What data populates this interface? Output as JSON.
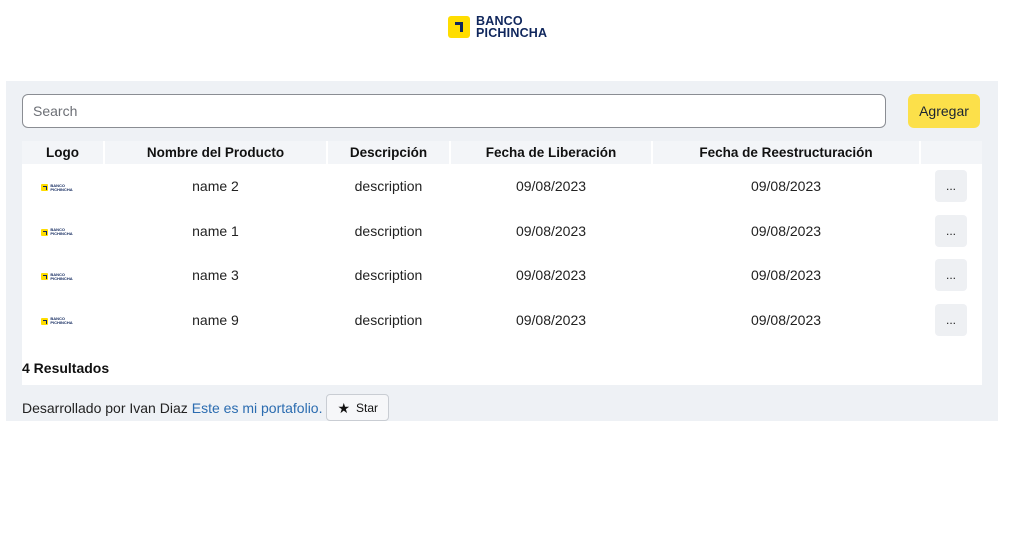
{
  "brand": {
    "line1": "BANCO",
    "line2": "PICHINCHA",
    "color": "#0f265c",
    "accent": "#ffdd00"
  },
  "search": {
    "placeholder": "Search",
    "value": ""
  },
  "toolbar": {
    "add_label": "Agregar"
  },
  "table": {
    "columns": [
      "Logo",
      "Nombre del Producto",
      "Descripción",
      "Fecha de Liberación",
      "Fecha de Reestructuración",
      ""
    ],
    "rows": [
      {
        "logo_line1": "BANCO",
        "logo_line2": "PICHINCHA",
        "name": "name 2",
        "description": "description",
        "release": "09/08/2023",
        "restructure": "09/08/2023",
        "action": "..."
      },
      {
        "logo_line1": "BANCO",
        "logo_line2": "PICHINCHA",
        "name": "name 1",
        "description": "description",
        "release": "09/08/2023",
        "restructure": "09/08/2023",
        "action": "..."
      },
      {
        "logo_line1": "BANCO",
        "logo_line2": "PICHINCHA",
        "name": "name 3",
        "description": "description",
        "release": "09/08/2023",
        "restructure": "09/08/2023",
        "action": "..."
      },
      {
        "logo_line1": "BANCO",
        "logo_line2": "PICHINCHA",
        "name": "name 9",
        "description": "description",
        "release": "09/08/2023",
        "restructure": "09/08/2023",
        "action": "..."
      }
    ]
  },
  "results": {
    "label": "4 Resultados"
  },
  "footer": {
    "text": "Desarrollado por Ivan Diaz",
    "link": "Este es mi portafolio.",
    "star_label": "Star",
    "star_icon": "star-icon"
  }
}
